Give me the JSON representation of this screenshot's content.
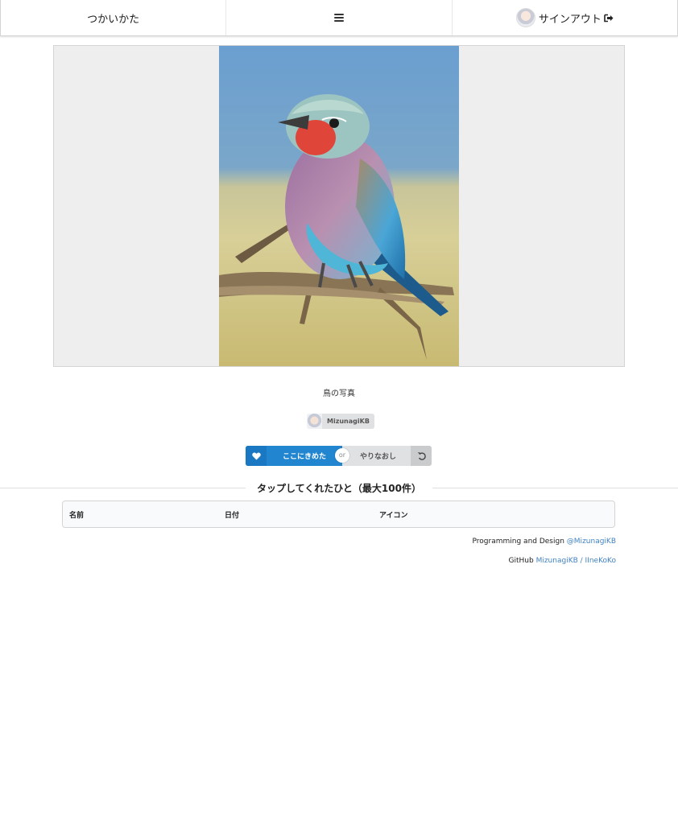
{
  "menu": {
    "howto_label": "つかいかた",
    "signout_label": "サインアウト"
  },
  "post": {
    "caption": "鳥の写真",
    "author_name": "MizunagiKB"
  },
  "actions": {
    "like_label": "ここにきめた",
    "or_label": "or",
    "redo_label": "やりなおし"
  },
  "section": {
    "title": "タップしてくれたひと（最大100件）"
  },
  "table": {
    "columns": [
      "名前",
      "日付",
      "アイコン"
    ]
  },
  "footer": {
    "credit_prefix": "Programming and Design",
    "credit_link": "@MizunagiKB",
    "github_prefix": "GitHub",
    "github_link": "MizunagiKB / IIneKoKo"
  },
  "colors": {
    "primary": "#2185d0",
    "link": "#4183c4"
  },
  "icons": {
    "menu": "hamburger-icon",
    "signout": "sign-out-icon",
    "like": "heart-icon",
    "redo": "undo-icon"
  }
}
